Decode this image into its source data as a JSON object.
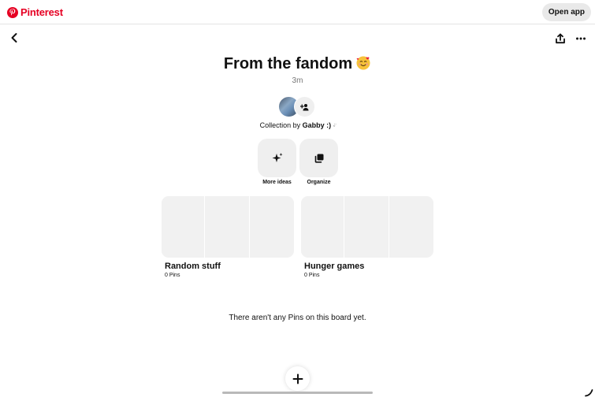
{
  "header": {
    "logo_text": "Pinterest",
    "open_app_label": "Open app"
  },
  "board": {
    "title": "From the fandom",
    "title_emoji": "smiling-face-with-hearts-emoji",
    "time": "3m",
    "collection_prefix": "Collection by ",
    "owner_name": "Gabby :)",
    "owner_suffix": "ᵕ̈",
    "actions": [
      {
        "label": "More ideas",
        "icon": "sparkle-icon"
      },
      {
        "label": "Organize",
        "icon": "organize-icon"
      }
    ],
    "sections": [
      {
        "name": "Random stuff",
        "count": "0 Pins"
      },
      {
        "name": "Hunger games",
        "count": "0 Pins"
      }
    ],
    "empty_message": "There aren't any Pins on this board yet."
  },
  "colors": {
    "brand": "#e60023",
    "surface": "#efefef",
    "text": "#111111",
    "muted": "#767676"
  }
}
